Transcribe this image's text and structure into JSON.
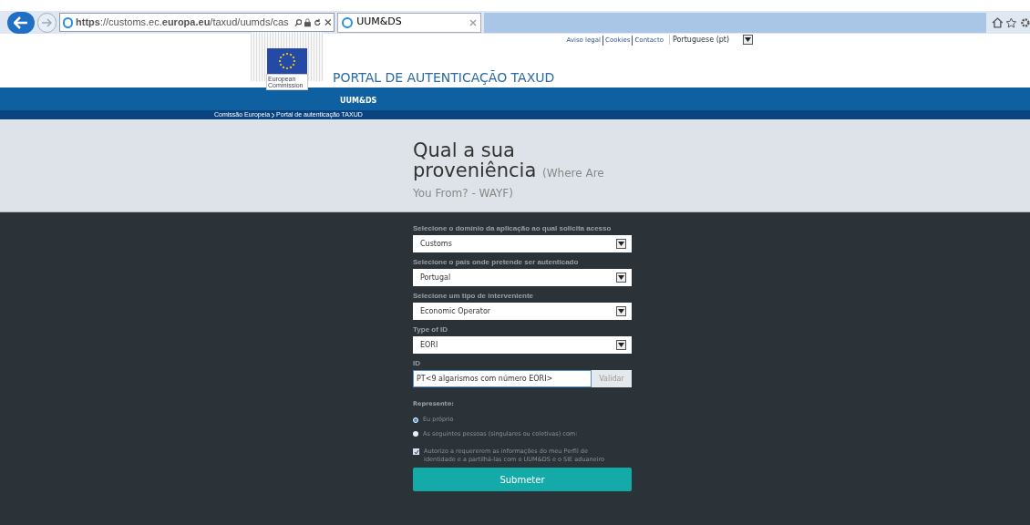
{
  "browser": {
    "url": "**https**://customs.ec.**europa.eu**/taxud/uumds/cas",
    "tab_title": "UUM&DS"
  },
  "top_links": [
    "Aviso legal",
    "Cookies",
    "Contacto"
  ],
  "language": {
    "value": "Portuguese (pt)"
  },
  "logo": {
    "line1": "European",
    "line2": "Commission"
  },
  "header": {
    "title": "PORTAL DE AUTENTICAÇÃO TAXUD",
    "subtitle": "UUM&DS"
  },
  "breadcrumb": [
    "Comissão Europeia",
    "Portal de autenticação TAXUD"
  ],
  "page_title": {
    "main": "Qual a sua proveniência",
    "sub": "(Where Are You From? - WAYF)"
  },
  "fields": [
    {
      "kind": "select",
      "label": "Selecione o domínio da aplicação ao qual solicita acesso",
      "value": "Customs"
    },
    {
      "kind": "select",
      "label": "Selecione o país onde pretende ser autenticado",
      "value": "Portugal"
    },
    {
      "kind": "select",
      "label": "Selecione um tipo de interveniente",
      "value": "Economic Operator"
    },
    {
      "kind": "select",
      "label": "Type of ID",
      "value": "EORI"
    },
    {
      "kind": "input",
      "label": "ID",
      "value": "PT<9 algarismos com número EORI>",
      "button": "Validar"
    }
  ],
  "represent": {
    "label": "Represento:",
    "options": [
      {
        "label": "Eu próprio",
        "selected": true
      },
      {
        "label": "As seguintes pessoas (singulares ou coletivas) com:",
        "selected": false
      }
    ]
  },
  "consent": {
    "label": "Autorizo a requererem as informações do meu Perfil de Identidade e a partilhá-las com o UUM&DS e o SIE aduaneiro",
    "checked": true
  },
  "submit": "Submeter"
}
